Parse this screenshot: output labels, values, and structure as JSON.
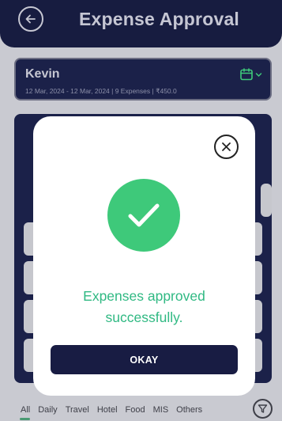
{
  "header": {
    "title": "Expense Approval",
    "back_icon": "arrow-left-icon"
  },
  "summary": {
    "name": "Kevin",
    "meta": "12 Mar, 2024 - 12 Mar, 2024 | 9 Expenses | ₹450.0",
    "calendar_icon": "calendar-icon",
    "accent_color": "#3ec97a"
  },
  "filters": {
    "items": [
      "All",
      "Daily",
      "Travel",
      "Hotel",
      "Food",
      "MIS",
      "Others"
    ],
    "active": "All",
    "filter_icon": "filter-icon"
  },
  "modal": {
    "message_line1": "Expenses approved",
    "message_line2": "successfully.",
    "okay_label": "OKAY",
    "close_icon": "close-icon",
    "success_icon": "checkmark-icon",
    "success_color": "#3ec97a",
    "button_color": "#181c43"
  }
}
